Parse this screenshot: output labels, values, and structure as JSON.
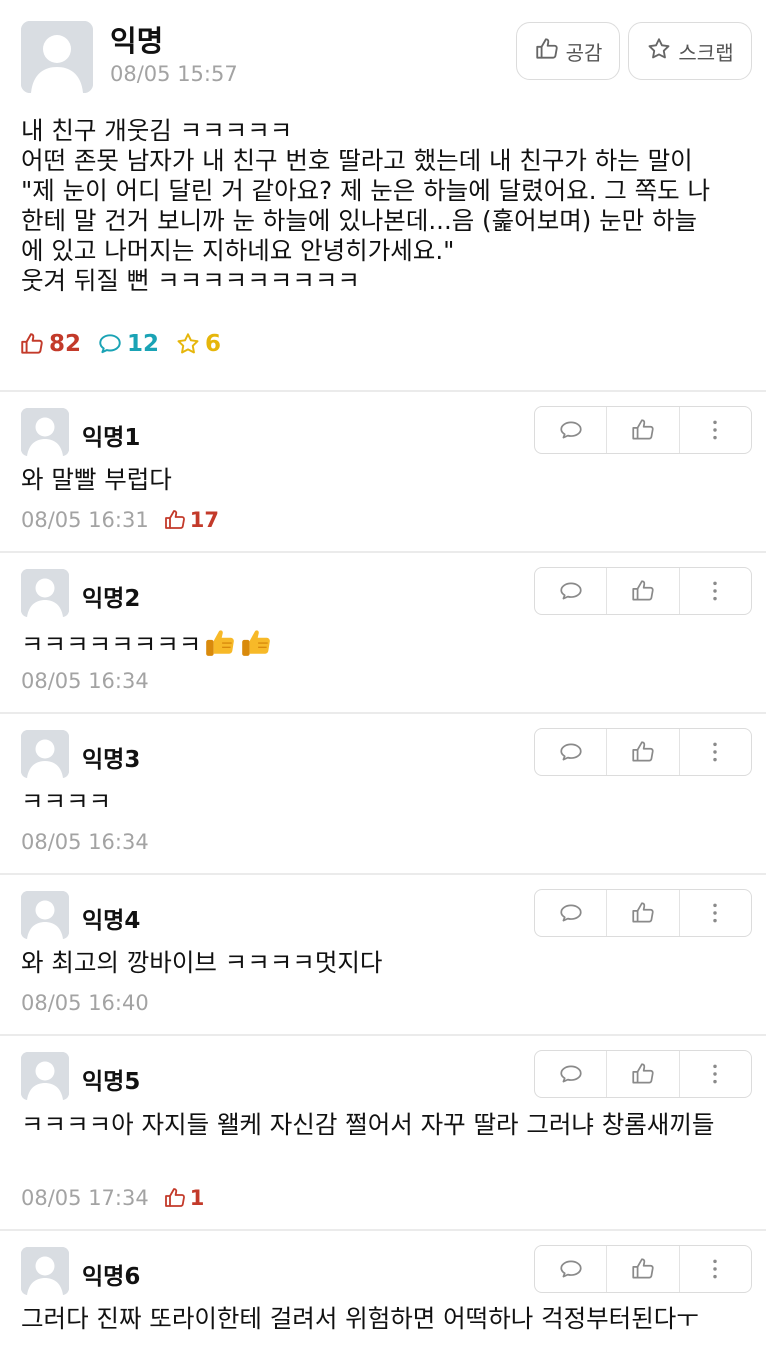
{
  "post": {
    "author": "익명",
    "time": "08/05 15:57",
    "like_button_label": "공감",
    "scrap_button_label": "스크랩",
    "body_lines": [
      "내 친구 개웃김 ㅋㅋㅋㅋㅋ",
      "어떤 존못 남자가 내 친구 번호 딸라고 했는데 내 친구가 하는 말이",
      "\"제 눈이 어디 달린 거 같아요? 제 눈은 하늘에 달렸어요. 그 쪽도 나",
      "한테 말 건거 보니까 눈 하늘에 있나본데...음 (훑어보며) 눈만 하늘",
      "에 있고 나머지는 지하네요 안녕히가세요.\"",
      "웃겨 뒤질 뻔 ㅋㅋㅋㅋㅋㅋㅋㅋㅋ"
    ],
    "likes": "82",
    "comments": "12",
    "scraps": "6"
  },
  "comments": [
    {
      "author": "익명1",
      "text": "와 말빨 부럽다",
      "time": "08/05 16:31",
      "likes": "17"
    },
    {
      "author": "익명2",
      "text": "ㅋㅋㅋㅋㅋㅋㅋㅋ",
      "time": "08/05 16:34",
      "likes": ""
    },
    {
      "author": "익명3",
      "text": "ㅋㅋㅋㅋ",
      "time": "08/05 16:34",
      "likes": ""
    },
    {
      "author": "익명4",
      "text": "와 최고의 깡바이브 ㅋㅋㅋㅋ멋지다",
      "time": "08/05 16:40",
      "likes": ""
    },
    {
      "author": "익명5",
      "text": "ㅋㅋㅋㅋ아 자지들 왤케 자신감 쩔어서 자꾸 딸라 그러냐 창롬새끼들",
      "time": "08/05 17:34",
      "likes": "1"
    },
    {
      "author": "익명6",
      "text": "그러다 진짜 또라이한테 걸려서 위험하면 어떡하나 걱정부터된다ㅜ",
      "time": "",
      "likes": ""
    }
  ],
  "icons": {
    "like": "thumbs-up-icon",
    "comment": "speech-bubble-icon",
    "scrap": "star-icon",
    "more": "vertical-dots-icon",
    "emoji": "thumbs-up-emoji"
  },
  "colors": {
    "like": "#c33a2a",
    "comment": "#1aa3b5",
    "scrap": "#e6b60b",
    "meta": "#a3a3a3"
  }
}
